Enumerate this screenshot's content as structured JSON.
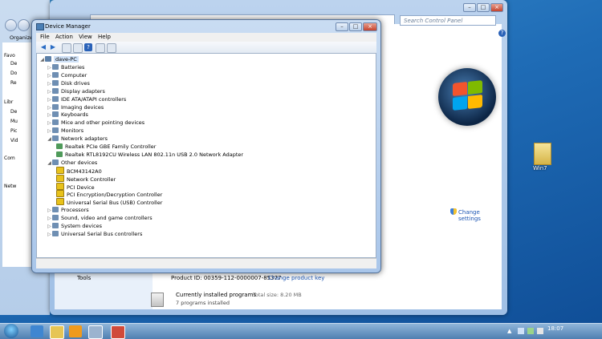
{
  "control_panel": {
    "search_placeholder": "Search Control Panel",
    "change_settings": "Change settings",
    "tools_label": "Tools",
    "product_id": "Product ID: 00359-112-0000007-85377",
    "change_product_key": "Change product key",
    "programs_title": "Currently installed programs",
    "programs_size": "Total size: 8.20 MB",
    "programs_count": "7 programs installed"
  },
  "left_pane": {
    "organize": "Organize",
    "items": [
      "Favo",
      "De",
      "Do",
      "Re",
      "Libr",
      "De",
      "Mu",
      "Pic",
      "Vid",
      "Com",
      "Netw"
    ]
  },
  "device_manager": {
    "title": "Device Manager",
    "menu": [
      "File",
      "Action",
      "View",
      "Help"
    ],
    "root": "dave-PC",
    "tree": [
      {
        "label": "Batteries",
        "level": 1,
        "expanded": false
      },
      {
        "label": "Computer",
        "level": 1,
        "expanded": false
      },
      {
        "label": "Disk drives",
        "level": 1,
        "expanded": false
      },
      {
        "label": "Display adapters",
        "level": 1,
        "expanded": false
      },
      {
        "label": "IDE ATA/ATAPI controllers",
        "level": 1,
        "expanded": false
      },
      {
        "label": "Imaging devices",
        "level": 1,
        "expanded": false
      },
      {
        "label": "Keyboards",
        "level": 1,
        "expanded": false
      },
      {
        "label": "Mice and other pointing devices",
        "level": 1,
        "expanded": false
      },
      {
        "label": "Monitors",
        "level": 1,
        "expanded": false
      },
      {
        "label": "Network adapters",
        "level": 1,
        "expanded": true
      },
      {
        "label": "Realtek PCIe GBE Family Controller",
        "level": 2
      },
      {
        "label": "Realtek RTL8192CU Wireless LAN 802.11n USB 2.0 Network Adapter",
        "level": 2
      },
      {
        "label": "Other devices",
        "level": 1,
        "expanded": true
      },
      {
        "label": "BCM43142A0",
        "level": 2,
        "warning": true
      },
      {
        "label": "Network Controller",
        "level": 2,
        "warning": true
      },
      {
        "label": "PCI Device",
        "level": 2,
        "warning": true
      },
      {
        "label": "PCI Encryption/Decryption Controller",
        "level": 2,
        "warning": true
      },
      {
        "label": "Universal Serial Bus (USB) Controller",
        "level": 2,
        "warning": true
      },
      {
        "label": "Processors",
        "level": 1,
        "expanded": false
      },
      {
        "label": "Sound, video and game controllers",
        "level": 1,
        "expanded": false
      },
      {
        "label": "System devices",
        "level": 1,
        "expanded": false
      },
      {
        "label": "Universal Serial Bus controllers",
        "level": 1,
        "expanded": false
      }
    ]
  },
  "desktop": {
    "icon_label": "Win7"
  },
  "taskbar": {
    "clock": "18:07"
  },
  "colors": {
    "link": "#1a54b2",
    "warning": "#e8c21b"
  }
}
